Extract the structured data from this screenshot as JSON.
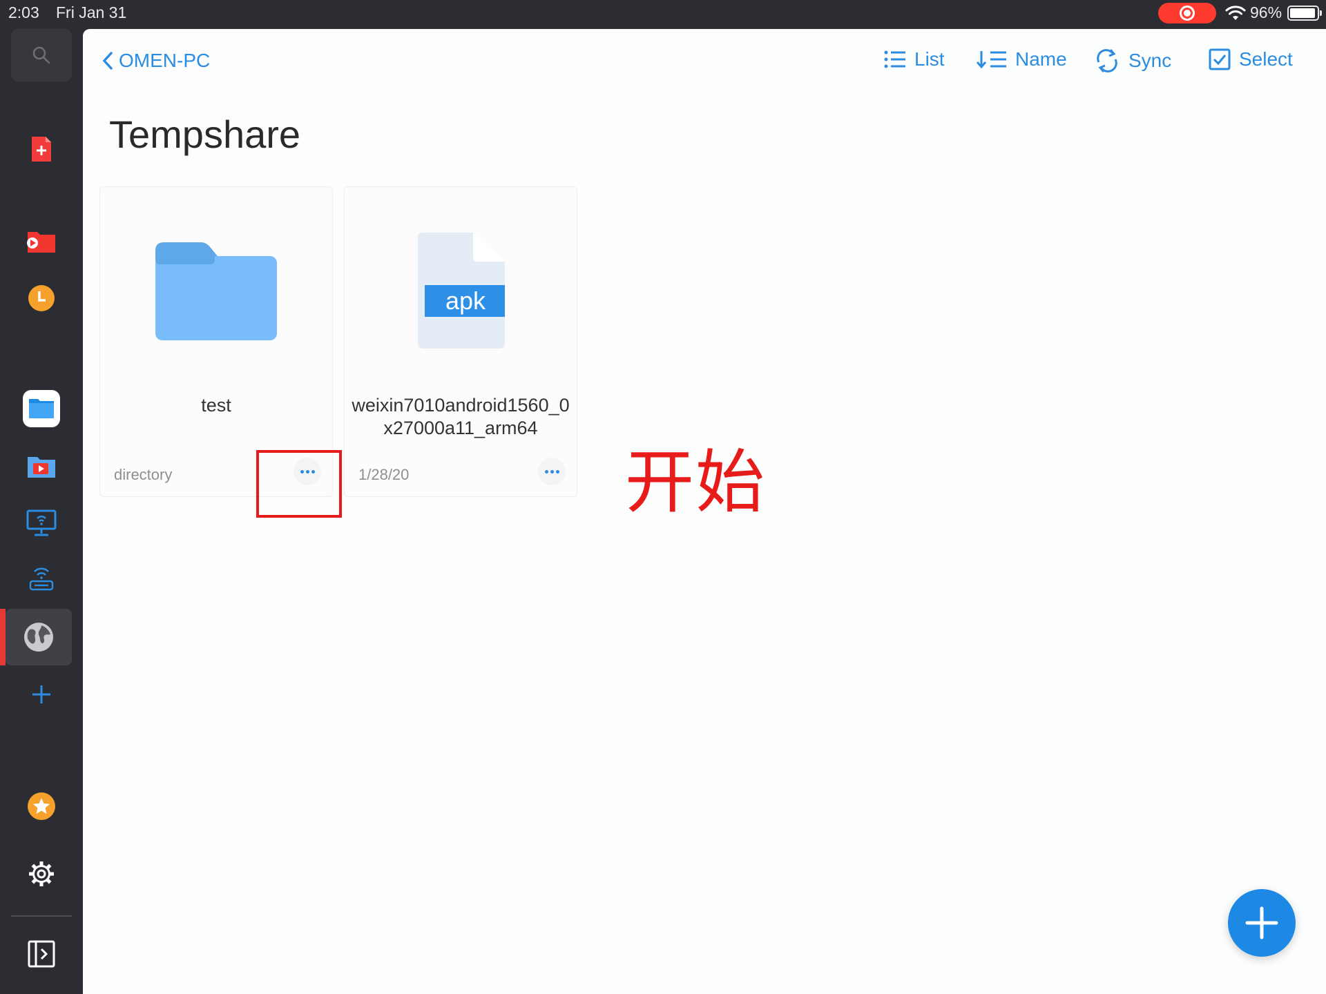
{
  "status_bar": {
    "time": "2:03",
    "date": "Fri Jan 31",
    "battery": "96%"
  },
  "nav": {
    "back_label": "OMEN-PC"
  },
  "toolbar": {
    "list_label": "List",
    "name_label": "Name",
    "sync_label": "Sync",
    "select_label": "Select"
  },
  "page": {
    "title": "Tempshare"
  },
  "items": [
    {
      "name": "test",
      "meta": "directory",
      "type": "folder"
    },
    {
      "name": "weixin7010android1560_0x27000a11_arm64",
      "meta": "1/28/20",
      "type": "apk",
      "badge": "apk"
    }
  ],
  "annotation": {
    "text": "开始"
  },
  "colors": {
    "accent": "#2c8ce0",
    "sidebar": "#2b2d33",
    "annotation": "#e81b1b",
    "fab": "#1e88e5"
  },
  "sidebar_icons": [
    "search-icon",
    "new-document-icon",
    "video-folder-icon",
    "recents-clock-icon",
    "files-icon",
    "media-folder-icon",
    "screen-share-icon",
    "wifi-transfer-icon",
    "network-globe-icon",
    "add-icon",
    "favorites-star-icon",
    "settings-gear-icon",
    "collapse-sidebar-icon"
  ]
}
